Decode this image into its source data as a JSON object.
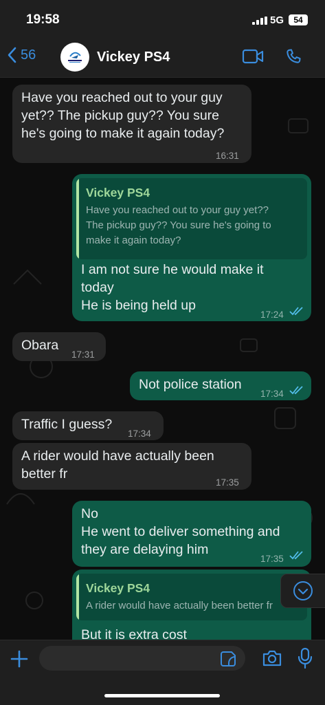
{
  "status_bar": {
    "time": "19:58",
    "network": "5G",
    "battery": "54"
  },
  "header": {
    "back_count": "56",
    "contact_name": "Vickey PS4",
    "avatar_icon": "business-logo-avatar",
    "video_icon": "video-camera-icon",
    "call_icon": "phone-icon"
  },
  "messages": [
    {
      "direction": "incoming",
      "lines": [
        "Have you reached out to your guy",
        "yet?? The pickup guy?? You sure",
        "he's going to make it again today?"
      ],
      "time": "16:31"
    },
    {
      "direction": "outgoing",
      "quote": {
        "name": "Vickey PS4",
        "lines": [
          "Have you reached out to your guy yet??",
          "The pickup guy?? You sure he's going to",
          "make it again today?"
        ]
      },
      "lines": [
        "I am not sure he would make it",
        "today",
        "He is being held up"
      ],
      "time": "17:24",
      "read": true
    },
    {
      "direction": "incoming",
      "lines": [
        "Obara"
      ],
      "time": "17:31"
    },
    {
      "direction": "outgoing",
      "lines": [
        "Not police station"
      ],
      "time": "17:34",
      "read": true
    },
    {
      "direction": "incoming",
      "lines": [
        "Traffic I guess?"
      ],
      "time": "17:34"
    },
    {
      "direction": "incoming",
      "lines": [
        "A rider would have actually been",
        "better fr"
      ],
      "time": "17:35"
    },
    {
      "direction": "outgoing",
      "lines": [
        "No",
        "He went to deliver something and",
        "they are delaying him"
      ],
      "time": "17:35",
      "read": true
    },
    {
      "direction": "outgoing",
      "quote": {
        "name": "Vickey PS4",
        "lines": [
          "A rider would have actually been better fr"
        ]
      },
      "lines": [
        "But it is extra cost"
      ]
    }
  ],
  "composer": {
    "input_value": "",
    "placeholder": ""
  },
  "colors": {
    "accent": "#3a8dde",
    "outgoing_bubble": "#0e5b47",
    "incoming_bubble": "#262626",
    "read_ticks": "#53bdeb"
  }
}
